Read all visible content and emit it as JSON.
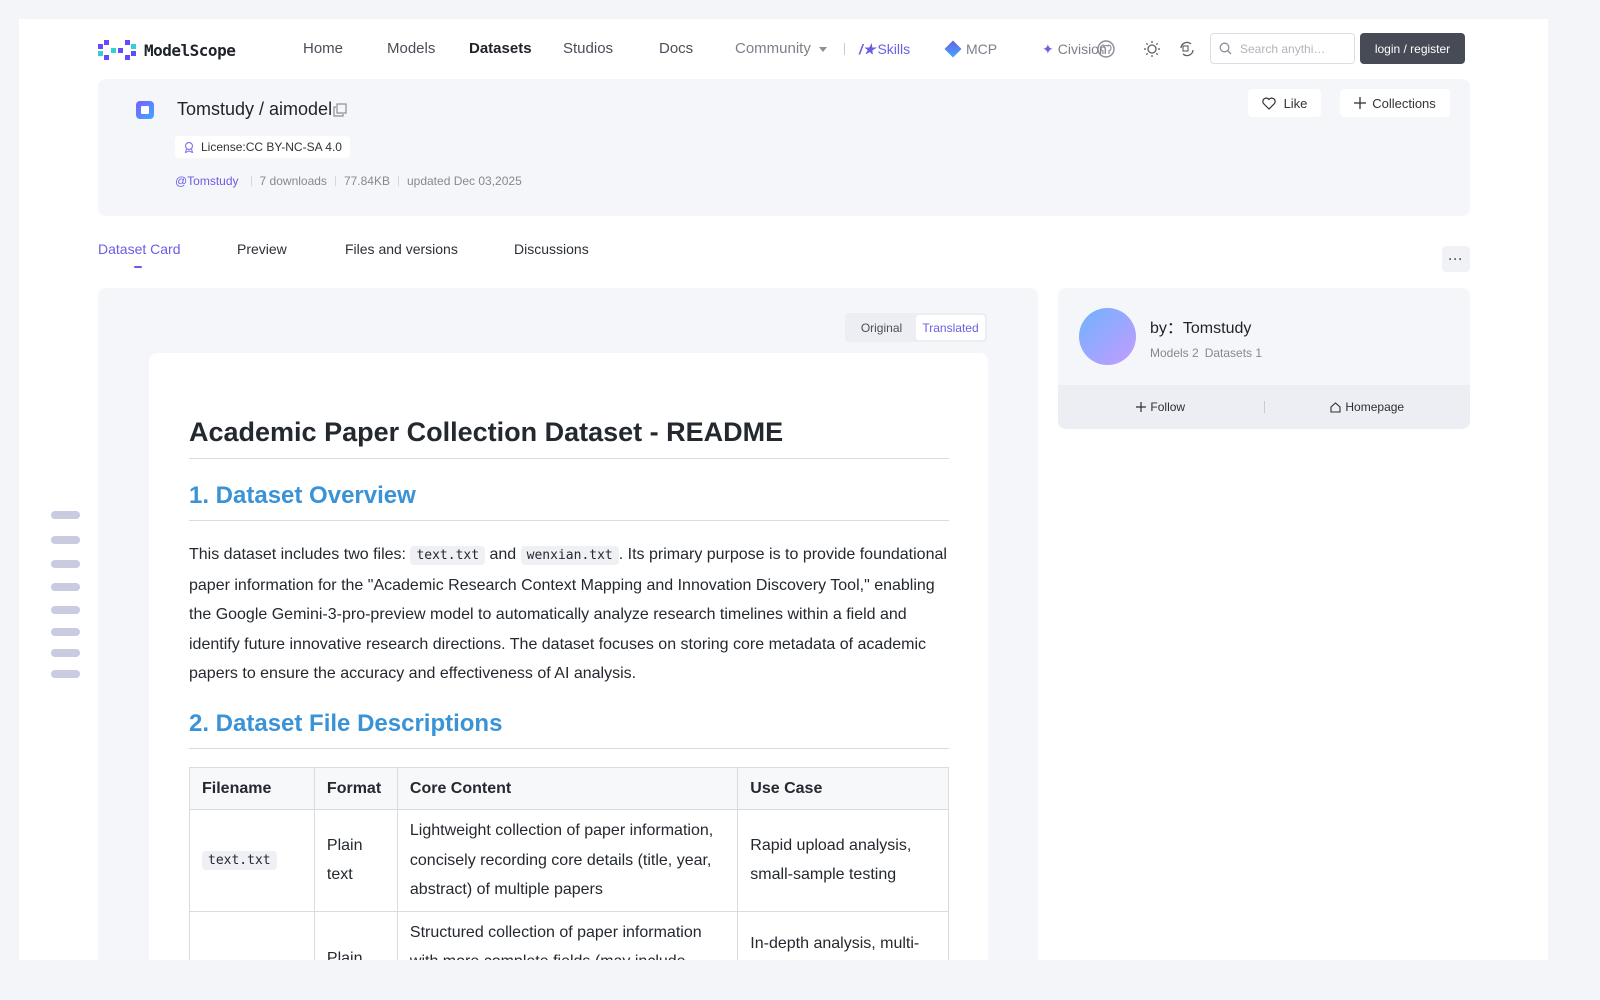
{
  "header": {
    "brand": "ModelScope",
    "nav": {
      "home": "Home",
      "models": "Models",
      "datasets": "Datasets",
      "studios": "Studios",
      "docs": "Docs",
      "community": "Community",
      "skills": "Skills",
      "mcp": "MCP",
      "civision": "Civision"
    },
    "search_placeholder": "Search anythi…",
    "login": "login / register",
    "icons": [
      "github-icon",
      "theme-sun-icon",
      "language-icon",
      "search-icon"
    ]
  },
  "repo": {
    "title": "Tomstudy / aimodel",
    "license": "License:CC BY-NC-SA 4.0",
    "author": "@Tomstudy",
    "downloads": "7 downloads",
    "size": "77.84KB",
    "updated": "updated Dec 03,2025",
    "like": "Like",
    "collections": "Collections"
  },
  "tabs": {
    "card": "Dataset Card",
    "preview": "Preview",
    "files": "Files and versions",
    "discussions": "Discussions"
  },
  "view_toggle": {
    "original": "Original",
    "translated": "Translated",
    "selected": "Translated"
  },
  "readme": {
    "title": "Academic Paper Collection Dataset - README",
    "h_overview": "1. Dataset Overview",
    "p1": "This dataset includes two files: ",
    "code1": "text.txt",
    "p2": " and ",
    "code2": "wenxian.txt",
    "p3": ". Its primary purpose is to provide foundational paper information for the \"Academic Research Context Mapping and Innovation Discovery Tool,\" enabling the Google Gemini-3-pro-preview model to automatically analyze research timelines within a field and identify future innovative research directions. The dataset focuses on storing core metadata of academic papers to ensure the accuracy and effectiveness of AI analysis.",
    "h_files": "2. Dataset File Descriptions",
    "table": {
      "headers": [
        "Filename",
        "Format",
        "Core Content",
        "Use Case"
      ],
      "rows": [
        [
          "text.txt",
          "Plain text",
          "Lightweight collection of paper information, concisely recording core details (title, year, abstract) of multiple papers",
          "Rapid upload analysis, small-sample testing"
        ],
        [
          "",
          "Plain",
          "Structured collection of paper information with more complete fields (may include",
          "In-depth analysis, multi-"
        ]
      ]
    }
  },
  "author_card": {
    "name": "by：Tomstudy",
    "models": "Models 2",
    "datasets": "Datasets 1",
    "follow": "Follow",
    "homepage": "Homepage"
  },
  "colors": {
    "accent": "#6a5ee3",
    "heading_blue": "#3a93d6",
    "login_bg": "#464b55"
  }
}
